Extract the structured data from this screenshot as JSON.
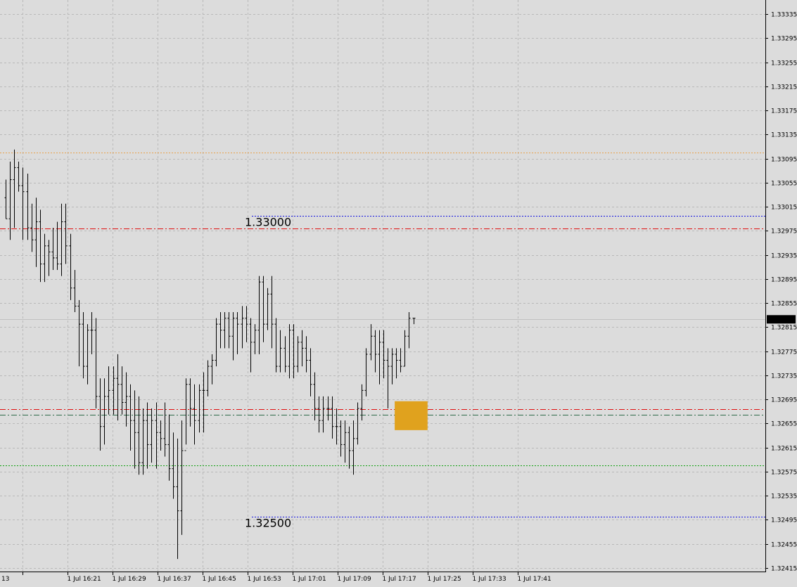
{
  "colors": {
    "background": "#dcdcdc",
    "grid": "#b9b9b9",
    "bars": "#000000",
    "axis_panel": "#ffffff",
    "current_price_box": "#000000",
    "current_price_text": "#ffffff",
    "highlight_zone": "#e0a21e"
  },
  "chart_data": {
    "type": "ohlc",
    "grid": true,
    "ylim": [
      1.32395,
      1.3336
    ],
    "y_ticks": [
      "1.33335",
      "1.33295",
      "1.33255",
      "1.33215",
      "1.33175",
      "1.33135",
      "1.33095",
      "1.33055",
      "1.33015",
      "1.32975",
      "1.32935",
      "1.32895",
      "1.32855",
      "1.32815",
      "1.32775",
      "1.32735",
      "1.32695",
      "1.32655",
      "1.32615",
      "1.32575",
      "1.32535",
      "1.32495",
      "1.32455",
      "1.32415"
    ],
    "x_ticks": [
      "13",
      "1 Jul 16:21",
      "1 Jul 16:29",
      "1 Jul 16:37",
      "1 Jul 16:45",
      "1 Jul 16:53",
      "1 Jul 17:01",
      "1 Jul 17:09",
      "1 Jul 17:17",
      "1 Jul 17:25",
      "1 Jul 17:33",
      "1 Jul 17:41"
    ],
    "current_price": "1.32828",
    "bars": [
      [
        1.3303,
        1.3306,
        1.32995,
        1.32995
      ],
      [
        1.32995,
        1.3309,
        1.3296,
        1.3306
      ],
      [
        1.3306,
        1.3311,
        1.3298,
        1.3308
      ],
      [
        1.3308,
        1.3309,
        1.3304,
        1.3305
      ],
      [
        1.3305,
        1.3308,
        1.3296,
        1.3304
      ],
      [
        1.3304,
        1.3307,
        1.3296,
        1.3298
      ],
      [
        1.3298,
        1.3302,
        1.3294,
        1.3296
      ],
      [
        1.3296,
        1.3303,
        1.32915,
        1.3299
      ],
      [
        1.3299,
        1.3301,
        1.3289,
        1.3292
      ],
      [
        1.3292,
        1.3297,
        1.3289,
        1.3295
      ],
      [
        1.3295,
        1.3296,
        1.329,
        1.3294
      ],
      [
        1.3294,
        1.3298,
        1.3291,
        1.3293
      ],
      [
        1.3293,
        1.3299,
        1.3291,
        1.3292
      ],
      [
        1.3292,
        1.3302,
        1.329,
        1.3299
      ],
      [
        1.3299,
        1.3302,
        1.3292,
        1.3295
      ],
      [
        1.3295,
        1.3297,
        1.3286,
        1.3288
      ],
      [
        1.3288,
        1.3291,
        1.3284,
        1.3285
      ],
      [
        1.3285,
        1.3286,
        1.3275,
        1.3282
      ],
      [
        1.3282,
        1.3284,
        1.3273,
        1.3275
      ],
      [
        1.3275,
        1.3282,
        1.3272,
        1.3281
      ],
      [
        1.3281,
        1.3284,
        1.3277,
        1.3281
      ],
      [
        1.3281,
        1.3283,
        1.3268,
        1.327
      ],
      [
        1.327,
        1.3273,
        1.3261,
        1.3265
      ],
      [
        1.3265,
        1.3273,
        1.3262,
        1.327
      ],
      [
        1.327,
        1.3275,
        1.3267,
        1.3271
      ],
      [
        1.3271,
        1.3275,
        1.3267,
        1.3273
      ],
      [
        1.3273,
        1.3277,
        1.3266,
        1.3272
      ],
      [
        1.3272,
        1.3275,
        1.3267,
        1.3269
      ],
      [
        1.3269,
        1.3274,
        1.3265,
        1.327
      ],
      [
        1.327,
        1.3272,
        1.3261,
        1.3266
      ],
      [
        1.3266,
        1.3271,
        1.3258,
        1.3264
      ],
      [
        1.3264,
        1.327,
        1.3257,
        1.3259
      ],
      [
        1.3259,
        1.3268,
        1.3257,
        1.3266
      ],
      [
        1.3266,
        1.3269,
        1.3258,
        1.3262
      ],
      [
        1.3262,
        1.3268,
        1.3259,
        1.3266
      ],
      [
        1.3266,
        1.3269,
        1.3258,
        1.3264
      ],
      [
        1.3264,
        1.3266,
        1.3261,
        1.3263
      ],
      [
        1.3263,
        1.3269,
        1.326,
        1.3262
      ],
      [
        1.3262,
        1.3267,
        1.3256,
        1.3258
      ],
      [
        1.3258,
        1.3264,
        1.3253,
        1.3255
      ],
      [
        1.3255,
        1.3263,
        1.3243,
        1.3251
      ],
      [
        1.3251,
        1.3266,
        1.3247,
        1.3261
      ],
      [
        1.3261,
        1.3273,
        1.3262,
        1.3272
      ],
      [
        1.3272,
        1.3273,
        1.3265,
        1.3268
      ],
      [
        1.3268,
        1.3272,
        1.3262,
        1.3266
      ],
      [
        1.3266,
        1.3272,
        1.3264,
        1.3271
      ],
      [
        1.3271,
        1.3274,
        1.3264,
        1.3271
      ],
      [
        1.3271,
        1.3276,
        1.327,
        1.3275
      ],
      [
        1.3275,
        1.3277,
        1.3272,
        1.3276
      ],
      [
        1.3276,
        1.3283,
        1.3275,
        1.3282
      ],
      [
        1.3282,
        1.3284,
        1.3278,
        1.3281
      ],
      [
        1.3281,
        1.3284,
        1.3278,
        1.3283
      ],
      [
        1.3283,
        1.3284,
        1.3278,
        1.328
      ],
      [
        1.328,
        1.3284,
        1.3276,
        1.3283
      ],
      [
        1.3283,
        1.3284,
        1.3277,
        1.3282
      ],
      [
        1.3282,
        1.3285,
        1.3278,
        1.3283
      ],
      [
        1.3283,
        1.3285,
        1.3279,
        1.3282
      ],
      [
        1.3282,
        1.3283,
        1.3274,
        1.3279
      ],
      [
        1.3279,
        1.3282,
        1.3277,
        1.3281
      ],
      [
        1.3281,
        1.329,
        1.3277,
        1.3289
      ],
      [
        1.3289,
        1.329,
        1.3279,
        1.3282
      ],
      [
        1.3282,
        1.3288,
        1.3281,
        1.3287
      ],
      [
        1.3287,
        1.329,
        1.3278,
        1.3282
      ],
      [
        1.3282,
        1.3283,
        1.3274,
        1.3275
      ],
      [
        1.3275,
        1.3281,
        1.3274,
        1.3278
      ],
      [
        1.3278,
        1.328,
        1.3274,
        1.3275
      ],
      [
        1.3275,
        1.3282,
        1.3273,
        1.3281
      ],
      [
        1.3281,
        1.3282,
        1.3273,
        1.3275
      ],
      [
        1.3275,
        1.328,
        1.3274,
        1.3279
      ],
      [
        1.3279,
        1.3281,
        1.3275,
        1.3278
      ],
      [
        1.3278,
        1.328,
        1.3274,
        1.3276
      ],
      [
        1.3276,
        1.3278,
        1.327,
        1.3272
      ],
      [
        1.3272,
        1.3274,
        1.3266,
        1.3268
      ],
      [
        1.3268,
        1.327,
        1.3264,
        1.3266
      ],
      [
        1.3266,
        1.327,
        1.3264,
        1.3268
      ],
      [
        1.3268,
        1.327,
        1.3266,
        1.3268
      ],
      [
        1.3268,
        1.327,
        1.3263,
        1.3265
      ],
      [
        1.3265,
        1.3268,
        1.3262,
        1.3265
      ],
      [
        1.3265,
        1.3266,
        1.326,
        1.3262
      ],
      [
        1.3262,
        1.3266,
        1.3259,
        1.3264
      ],
      [
        1.3264,
        1.3265,
        1.3258,
        1.3261
      ],
      [
        1.3261,
        1.3266,
        1.3257,
        1.3263
      ],
      [
        1.3263,
        1.3269,
        1.3262,
        1.3268
      ],
      [
        1.3268,
        1.3272,
        1.3266,
        1.3271
      ],
      [
        1.3271,
        1.3278,
        1.327,
        1.3277
      ],
      [
        1.3277,
        1.3282,
        1.3276,
        1.328
      ],
      [
        1.328,
        1.3281,
        1.3274,
        1.3277
      ],
      [
        1.3277,
        1.3281,
        1.3272,
        1.3279
      ],
      [
        1.3279,
        1.3281,
        1.3273,
        1.3276
      ],
      [
        1.3276,
        1.3278,
        1.3268,
        1.3275
      ],
      [
        1.3275,
        1.3278,
        1.3272,
        1.3277
      ],
      [
        1.3277,
        1.3278,
        1.3273,
        1.3276
      ],
      [
        1.3276,
        1.3278,
        1.3274,
        1.3275
      ],
      [
        1.3275,
        1.3281,
        1.3275,
        1.328
      ],
      [
        1.328,
        1.3284,
        1.3278,
        1.3283
      ],
      [
        1.3283,
        1.3283,
        1.3282,
        1.3283
      ]
    ],
    "levels": [
      {
        "value": 1.33105,
        "style": "dotted",
        "color": "#e8a14a"
      },
      {
        "value": 1.33,
        "style": "dotted",
        "color": "#1010e0",
        "label": "1.33000"
      },
      {
        "value": 1.32979,
        "style": "dashdot",
        "color": "#e01010"
      },
      {
        "value": 1.32679,
        "style": "dashdot",
        "color": "#e01010"
      },
      {
        "value": 1.3267,
        "style": "dashdot",
        "color": "#2e6b4a"
      },
      {
        "value": 1.32585,
        "style": "dotted",
        "color": "#10a010"
      },
      {
        "value": 1.325,
        "style": "dotted",
        "color": "#1010e0",
        "label": "1.32500"
      }
    ],
    "highlight_zone": {
      "y_top": 1.32692,
      "y_bottom": 1.32644,
      "from_bar": 91,
      "to_bar": 98
    }
  }
}
